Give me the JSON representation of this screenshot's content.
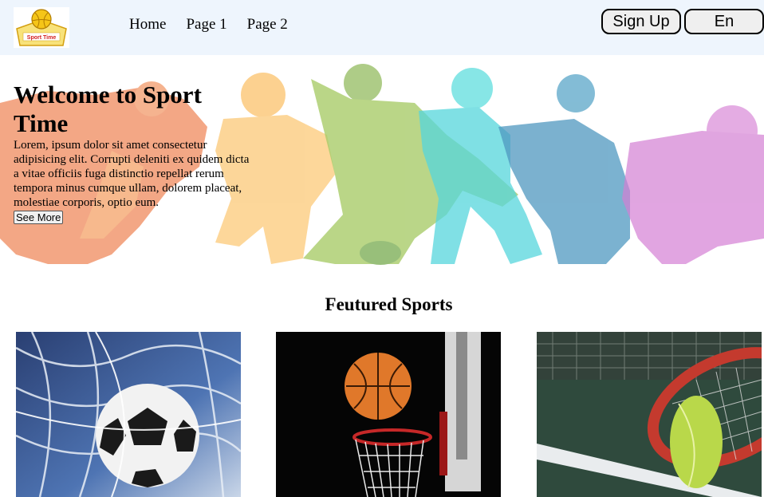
{
  "header": {
    "logo_text": "Sport Time",
    "nav": [
      "Home",
      "Page 1",
      "Page 2"
    ],
    "signup_label": "Sign Up",
    "language_label": "En"
  },
  "hero": {
    "title": "Welcome to Sport Time",
    "body": "Lorem, ipsum dolor sit amet consectetur adipisicing elit. Corrupti deleniti ex quidem dicta a vitae officiis fuga distinctio repellat rerum tempora minus cumque ullam, dolorem placeat, molestiae corporis, optio eum.",
    "cta_label": "See More"
  },
  "featured": {
    "title": "Feutured Sports",
    "cards": [
      {
        "icon": "soccer-ball"
      },
      {
        "icon": "basketball"
      },
      {
        "icon": "tennis-racket-ball"
      }
    ]
  }
}
